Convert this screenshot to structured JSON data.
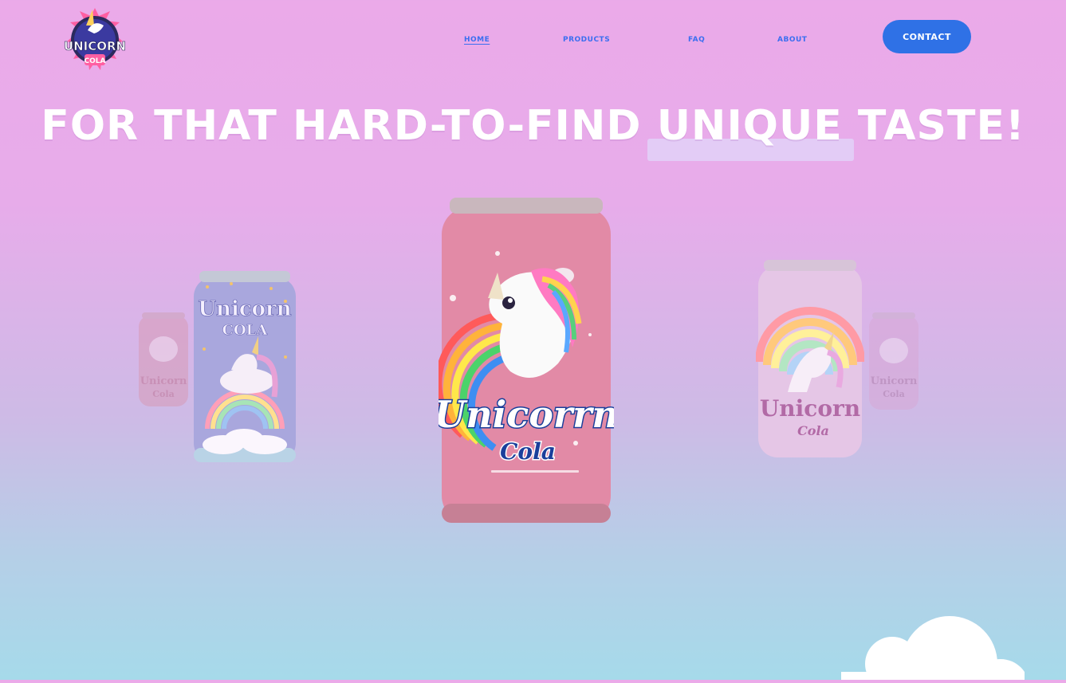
{
  "brand": {
    "logo_text_top": "UNICORN",
    "logo_text_bottom": "COLA"
  },
  "nav": {
    "items": [
      {
        "label": "HOME",
        "active": true
      },
      {
        "label": "PRODUCTS",
        "active": false
      },
      {
        "label": "FAQ",
        "active": false
      },
      {
        "label": "ABOUT",
        "active": false
      }
    ],
    "contact_label": "CONTACT"
  },
  "hero": {
    "before": "FOR THAT HARD-TO-FIND",
    "highlight": "UNIQUE",
    "after": "TASTE!"
  },
  "products": [
    {
      "name": "Unicorn",
      "sub": "Cola",
      "color": "#d89bb6",
      "position": "far-left"
    },
    {
      "name": "Unicorn",
      "sub": "COLA",
      "color": "#a9a7dd",
      "position": "left"
    },
    {
      "name": "Unicorrn",
      "sub": "Cola",
      "color": "#e28aa6",
      "position": "center"
    },
    {
      "name": "Unicorn",
      "sub": "Cola",
      "color": "#e5c6e6",
      "position": "right"
    },
    {
      "name": "Unicorn",
      "sub": "Cola",
      "color": "#d8a8d6",
      "position": "far-right"
    }
  ],
  "colors": {
    "accent": "#2f71e6",
    "nav_text": "#3b6ef0",
    "bg_top": "#ebaae9",
    "bg_bottom": "#a6daea"
  }
}
